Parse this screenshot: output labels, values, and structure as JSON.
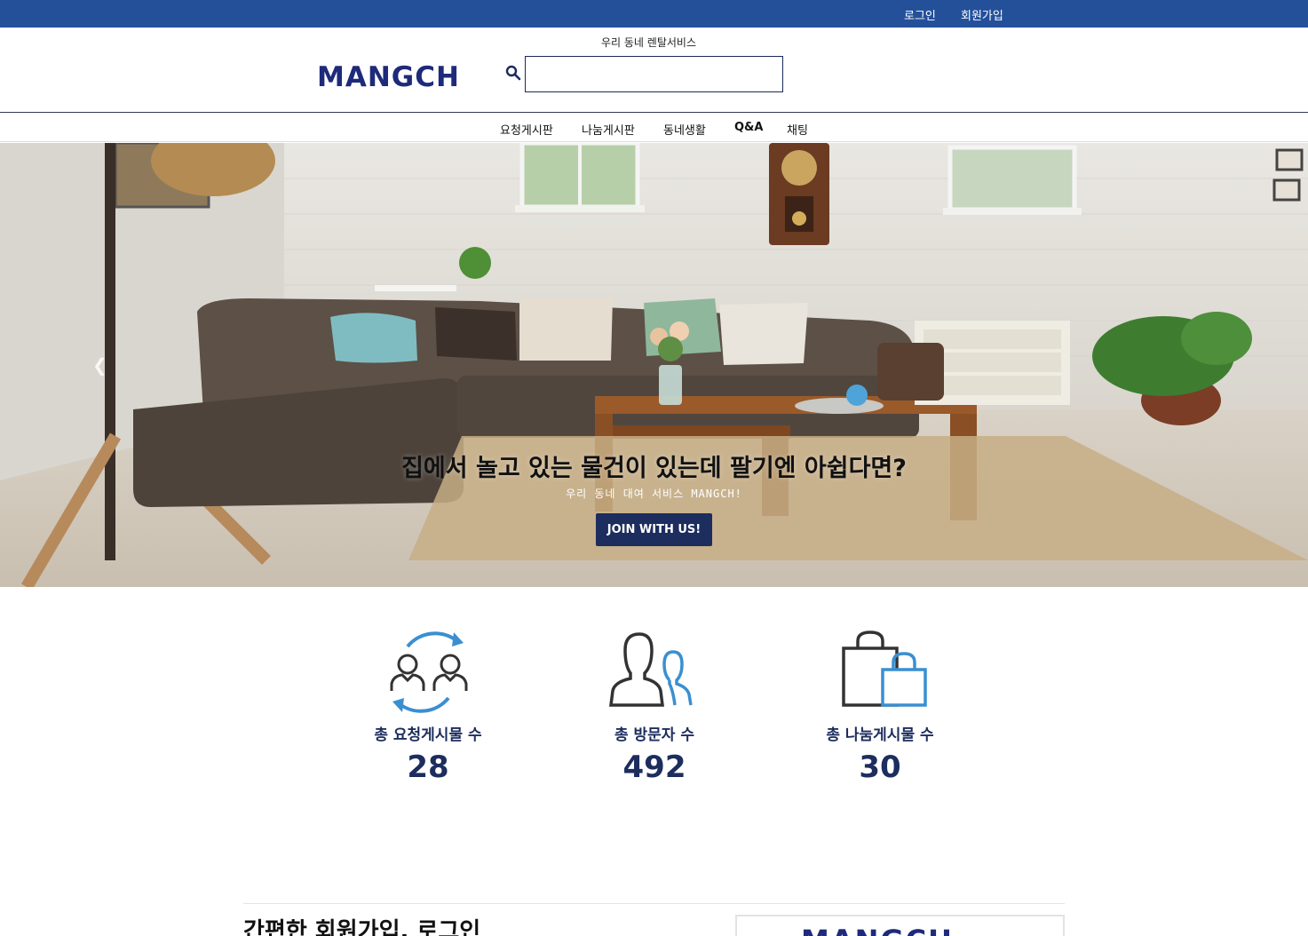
{
  "topbar": {
    "login": "로그인",
    "signup": "회원가입"
  },
  "header": {
    "logo": "MANGCH",
    "tagline": "우리 동네 렌탈서비스",
    "search_value": ""
  },
  "nav": {
    "items": [
      "요청게시판",
      "나눔게시판",
      "동네생활",
      "Q&A",
      "채팅"
    ]
  },
  "hero": {
    "title": "집에서 놀고 있는 물건이 있는데 팔기엔 아쉽다면?",
    "subtitle": "우리 동네 대여 서비스 MANGCH!",
    "button": "JOIN WITH US!",
    "prev_icon": "chevron-left-icon"
  },
  "stats": [
    {
      "label": "총 요청게시물 수",
      "value": "28",
      "icon": "users-exchange-icon"
    },
    {
      "label": "총 방문자 수",
      "value": "492",
      "icon": "visitors-icon"
    },
    {
      "label": "총 나눔게시물 수",
      "value": "30",
      "icon": "shopping-bags-icon"
    }
  ],
  "bottom": {
    "title": "간편한 회원가입, 로그인",
    "preview_logo": "MANGCH"
  },
  "colors": {
    "topbar": "#24509a",
    "brand_navy": "#1c2d5e",
    "accent_blue": "#3a8fd1",
    "icon_dark": "#333333"
  }
}
